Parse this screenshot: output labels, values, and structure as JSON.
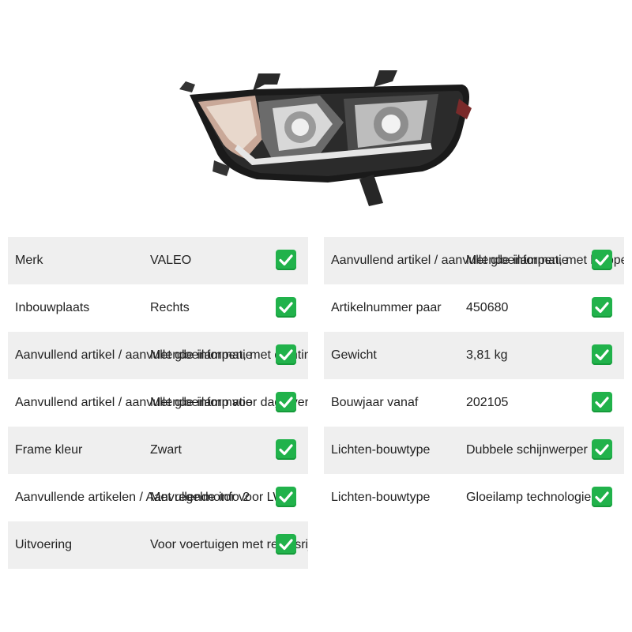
{
  "product_image": {
    "alt": "headlight",
    "icon": "headlight-image"
  },
  "specs_left": [
    {
      "label": "Merk",
      "value": "VALEO"
    },
    {
      "label": "Inbouwplaats",
      "value": "Rechts"
    },
    {
      "label": "Aanvullend artikel / aanvullende informatie",
      "value": "Met gloeilampen, met dichtingen"
    },
    {
      "label": "Aanvullend artikel / aanvullende informatie",
      "value": "Met gloeilamp voor dagrijverlichting"
    },
    {
      "label": "Frame kleur",
      "value": "Zwart"
    },
    {
      "label": "Aanvullende artikelen / Aanvullende info 2",
      "value": "Met regelmotor voor LWR"
    },
    {
      "label": "Uitvoering",
      "value": "Voor voertuigen met rechtsrijdend verkeer"
    }
  ],
  "specs_right": [
    {
      "label": "Aanvullend artikel / aanvullende informatie",
      "value": "Met gloeilampen, met knipperlicht"
    },
    {
      "label": "Artikelnummer paar",
      "value": "450680"
    },
    {
      "label": "Gewicht",
      "value": "3,81 kg"
    },
    {
      "label": "Bouwjaar vanaf",
      "value": "202105"
    },
    {
      "label": "Lichten-bouwtype",
      "value": "Dubbele schijnwerper"
    },
    {
      "label": "Lichten-bouwtype",
      "value": "Gloeilamp technologie"
    }
  ],
  "check_icon": "check-mark-icon",
  "colors": {
    "row_shade": "#efefef",
    "check_green": "#21b24b"
  }
}
